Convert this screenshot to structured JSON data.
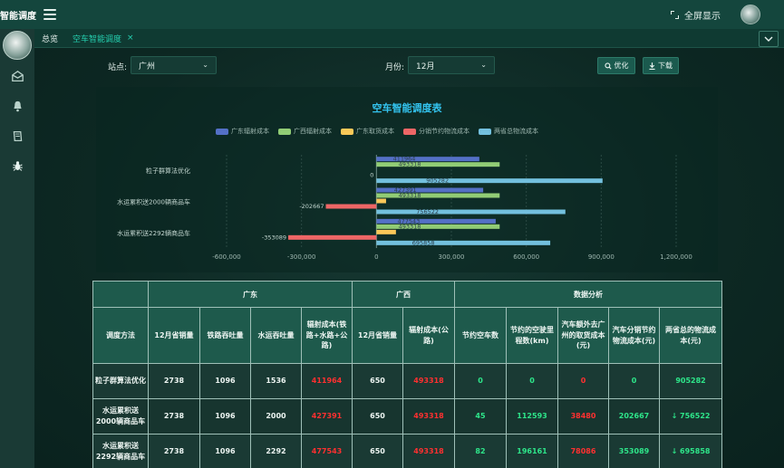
{
  "app": {
    "title": "智能调度"
  },
  "header": {
    "fullscreen_label": "全屏显示"
  },
  "tabs": {
    "home": "总览",
    "active": "空车智能调度",
    "close": "×"
  },
  "filters": {
    "site_label": "站点:",
    "site_value": "广州",
    "month_label": "月份:",
    "month_value": "12月",
    "optimize_label": "优化",
    "download_label": "下载"
  },
  "chart_data": {
    "type": "bar",
    "orientation": "horizontal",
    "title": "空车智能调度表",
    "categories": [
      "粒子群算法优化",
      "水运累积送2000辆商品车",
      "水运累积送2292辆商品车"
    ],
    "series": [
      {
        "name": "广东辐射成本",
        "color": "#5470c6",
        "values": [
          411964,
          427391,
          477543
        ]
      },
      {
        "name": "广西辐射成本",
        "color": "#91cc75",
        "values": [
          493318,
          493318,
          493318
        ]
      },
      {
        "name": "广东取货成本",
        "color": "#fac858",
        "values": [
          0,
          38480,
          78086
        ]
      },
      {
        "name": "分销节约物流成本",
        "color": "#ee6666",
        "values": [
          0,
          -202667,
          -353089
        ]
      },
      {
        "name": "两省总物流成本",
        "color": "#73c0de",
        "values": [
          905282,
          756522,
          695858
        ]
      }
    ],
    "data_labels": [
      [
        "411964",
        "493318",
        "",
        "0",
        "905282"
      ],
      [
        "427391",
        "493318",
        "",
        "-202667",
        "756522"
      ],
      [
        "477543",
        "493318",
        "",
        "-353089",
        "695858"
      ]
    ],
    "xlim": [
      -600000,
      1200000
    ],
    "xticks": [
      "-600,000",
      "-300,000",
      "0",
      "300,000",
      "600,000",
      "900,000",
      "1,200,000"
    ],
    "grid": true
  },
  "table": {
    "groups": [
      "广东",
      "广西",
      "数据分析"
    ],
    "headers": [
      "调度方法",
      "12月省销量",
      "铁路吞吐量",
      "水运吞吐量",
      "辐射成本(铁路+水路+公路)",
      "12月省销量",
      "辐射成本(公路)",
      "节约空车数",
      "节约的空驶里程数(km)",
      "汽车额外去广州的取货成本(元)",
      "汽车分销节约物流成本(元)",
      "两省总的物流成本(元)"
    ],
    "rows": [
      [
        "粒子群算法优化",
        "2738",
        "1096",
        "1536",
        "411964",
        "650",
        "493318",
        "0",
        "0",
        "0",
        "0",
        "905282"
      ],
      [
        "水运累积送2000辆商品车",
        "2738",
        "1096",
        "2000",
        "427391",
        "650",
        "493318",
        "45",
        "112593",
        "38480",
        "202667",
        "↓ 756522"
      ],
      [
        "水运累积送2292辆商品车",
        "2738",
        "1096",
        "2292",
        "477543",
        "650",
        "493318",
        "82",
        "196161",
        "78086",
        "353089",
        "↓ 695858"
      ]
    ]
  },
  "icons": {
    "sidebar": [
      "envelope-icon",
      "bell-icon",
      "book-icon",
      "bug-icon"
    ]
  },
  "colors": {
    "accent": "#25d0b0",
    "title_blue": "#33c4f0",
    "negative_red": "#ff3030",
    "positive_green": "#2ee68a"
  }
}
